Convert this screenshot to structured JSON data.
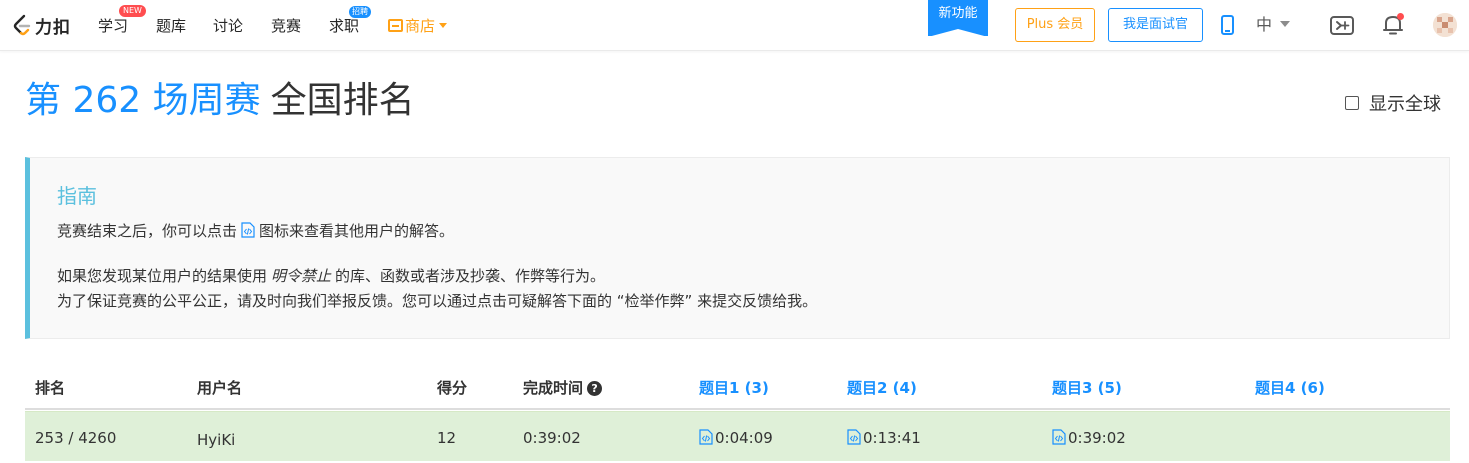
{
  "nav": {
    "logo_text": "力扣",
    "items": [
      {
        "label": "学习",
        "badge": "NEW"
      },
      {
        "label": "题库"
      },
      {
        "label": "讨论"
      },
      {
        "label": "竞赛"
      },
      {
        "label": "求职",
        "badge": "招聘"
      },
      {
        "label": "商店"
      }
    ],
    "new_feature": "新功能",
    "plus_button": "Plus 会员",
    "interviewer_button": "我是面试官",
    "language": "中",
    "icons": [
      "mobile-icon",
      "console-icon",
      "bell-icon",
      "avatar"
    ],
    "colors": {
      "accent": "#1890ff",
      "shop": "#ffa116",
      "badge": "#ff4d4f"
    }
  },
  "page": {
    "title_contest": "第 262 场周赛",
    "title_rank": "全国排名",
    "show_global": "显示全球"
  },
  "guide": {
    "title": "指南",
    "line1_before": "竞赛结束之后，你可以点击",
    "line1_after": "图标来查看其他用户的解答。",
    "line2_before": "如果您发现某位用户的结果使用",
    "line2_em": "明令禁止",
    "line2_after": "的库、函数或者涉及抄袭、作弊等行为。",
    "line3": "为了保证竞赛的公平公正，请及时向我们举报反馈。您可以通过点击可疑解答下面的 “检举作弊” 来提交反馈给我。",
    "accent": "#5bc0de"
  },
  "table": {
    "headers": {
      "rank": "排名",
      "username": "用户名",
      "score": "得分",
      "finish_time": "完成时间",
      "q1": "题目1 (3)",
      "q2": "题目2 (4)",
      "q3": "题目3 (5)",
      "q4": "题目4 (6)"
    },
    "rows": [
      {
        "rank": "253 / 4260",
        "username": "HyiKi",
        "score": "12",
        "finish_time": "0:39:02",
        "q1": "0:04:09",
        "q2": "0:13:41",
        "q3": "0:39:02",
        "q4": ""
      }
    ],
    "row_highlight": "#dff0d8"
  }
}
